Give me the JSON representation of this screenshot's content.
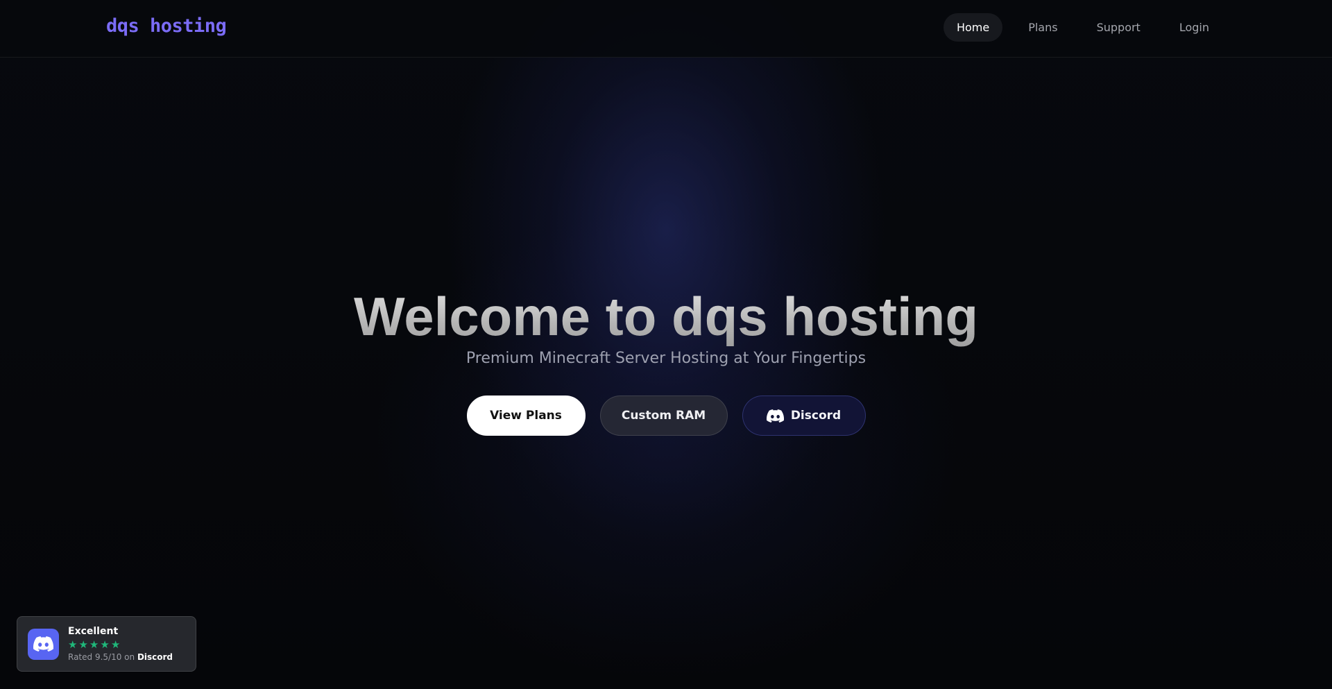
{
  "header": {
    "logo": "dqs hosting",
    "nav": [
      {
        "label": "Home",
        "active": true
      },
      {
        "label": "Plans",
        "active": false
      },
      {
        "label": "Support",
        "active": false
      },
      {
        "label": "Login",
        "active": false
      }
    ]
  },
  "hero": {
    "title": "Welcome to dqs hosting",
    "subtitle": "Premium Minecraft Server Hosting at Your Fingertips",
    "buttons": {
      "view_plans": "View Plans",
      "custom_ram": "Custom RAM",
      "discord": "Discord"
    }
  },
  "badge": {
    "title": "Excellent",
    "stars": 5,
    "rating_prefix": "Rated 9.5/10 on",
    "platform": "Discord",
    "icon": "discord-icon"
  },
  "colors": {
    "brand": "#7b6cf6",
    "discord": "#5865f2",
    "star": "#1fb87a",
    "background": "#050608"
  }
}
